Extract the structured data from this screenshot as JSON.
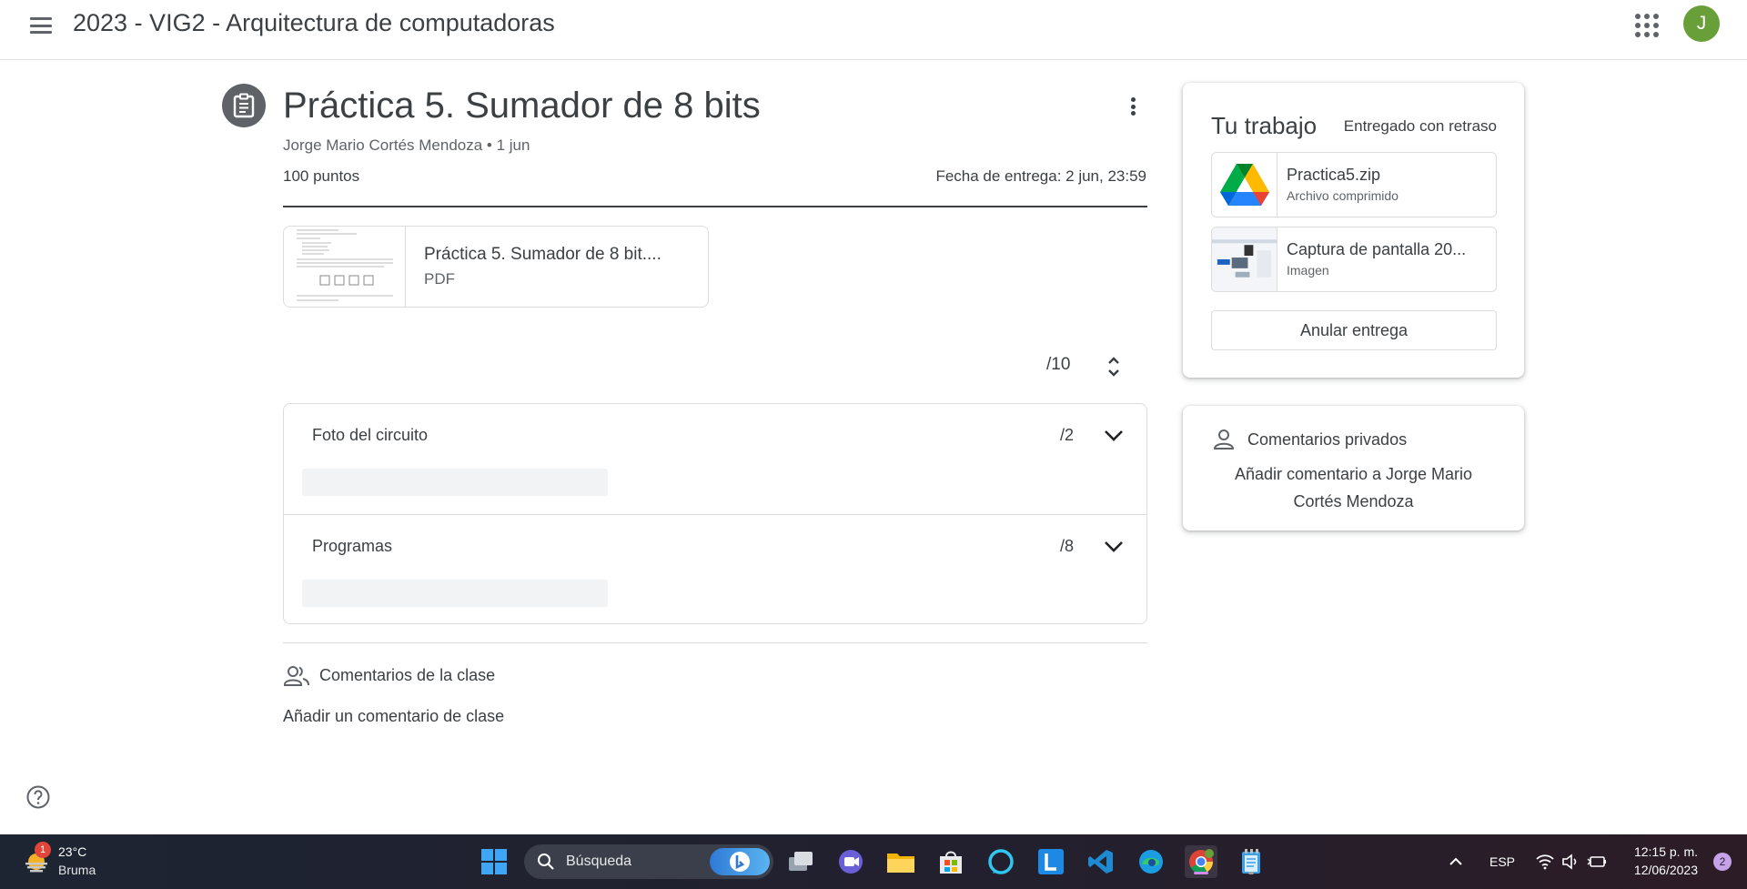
{
  "header": {
    "class_title": "2023 - VIG2 - Arquitectura de computadoras",
    "avatar_initial": "J"
  },
  "assignment": {
    "title": "Práctica 5. Sumador de 8 bits",
    "author_date": "Jorge Mario Cortés Mendoza • 1 jun",
    "points": "100 puntos",
    "due": "Fecha de entrega: 2 jun, 23:59",
    "attachment": {
      "name": "Práctica 5. Sumador de 8 bit....",
      "type": "PDF"
    },
    "score_total": "/10",
    "rubric": [
      {
        "name": "Foto del circuito",
        "score": "/2"
      },
      {
        "name": "Programas",
        "score": "/8"
      }
    ],
    "class_comments_label": "Comentarios de la clase",
    "add_class_comment": "Añadir un comentario de clase"
  },
  "your_work": {
    "heading": "Tu trabajo",
    "status": "Entregado con retraso",
    "files": [
      {
        "name": "Practica5.zip",
        "type": "Archivo comprimido",
        "icon": "google-drive-icon"
      },
      {
        "name": "Captura de pantalla 20...",
        "type": "Imagen",
        "icon": "image-thumbnail"
      }
    ],
    "unsubmit_label": "Anular entrega"
  },
  "private_comments": {
    "label": "Comentarios privados",
    "add": "Añadir comentario a Jorge Mario Cortés Mendoza"
  },
  "taskbar": {
    "weather_badge": "1",
    "weather_temp": "23°C",
    "weather_desc": "Bruma",
    "search_text": "Búsqueda",
    "language": "ESP",
    "time": "12:15 p. m.",
    "date": "12/06/2023",
    "notification_count": "2"
  },
  "colors": {
    "text": "#3c4043",
    "secondary_text": "#5f6368",
    "avatar": "#689f38",
    "border": "#dadce0"
  }
}
